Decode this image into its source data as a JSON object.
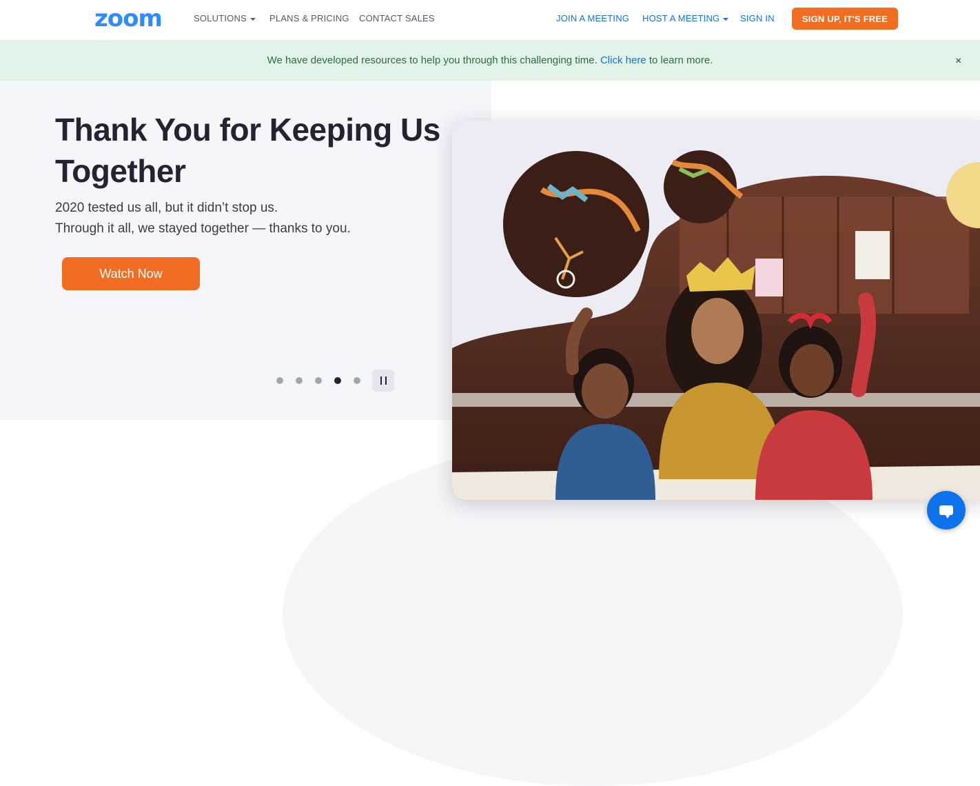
{
  "nav": {
    "logo": "zoom",
    "solutions": "SOLUTIONS",
    "plans": "PLANS & PRICING",
    "contact": "CONTACT SALES",
    "join": "JOIN A MEETING",
    "host": "HOST A MEETING",
    "signin": "SIGN IN",
    "signup": "SIGN UP, IT'S FREE"
  },
  "banner": {
    "text_before": "We have developed resources to help you through this challenging time.",
    "link": "Click here",
    "text_after": "to learn more.",
    "close": "×"
  },
  "hero": {
    "title": "Thank You for Keeping Us Together",
    "line1": "2020 tested us all, but it didn’t stop us.",
    "line2": "Through it all, we stayed together — thanks to you.",
    "cta": "Watch Now"
  },
  "carousel": {
    "slide_count": 5,
    "active_slide": 4
  },
  "colors": {
    "brand_blue": "#2d8cff",
    "link_blue": "#0e72ed",
    "cta_orange": "#f26d21",
    "banner_green_bg": "#e2f4e8",
    "banner_green_text": "#2b6e3e"
  }
}
